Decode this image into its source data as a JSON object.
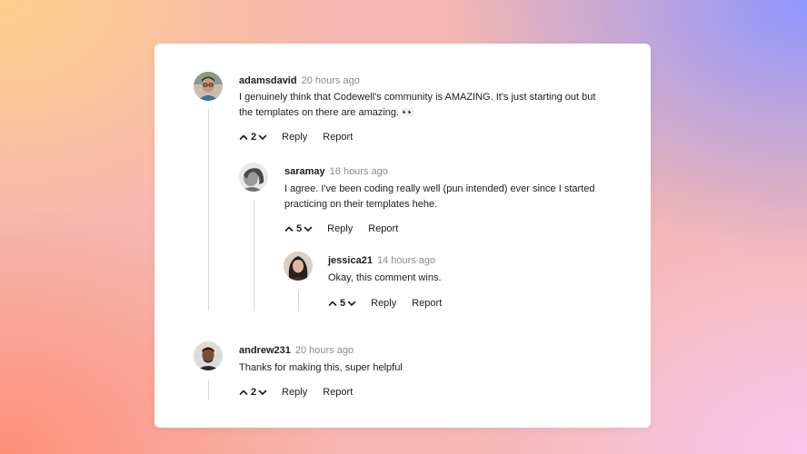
{
  "comments": [
    {
      "username": "adamsdavid",
      "time": "20 hours ago",
      "lines": [
        "I genuinely think that Codewell's community is AMAZING. It's just starting out but",
        "the templates on there are amazing. 👀"
      ],
      "votes": "2",
      "reply": "Reply",
      "report": "Report"
    },
    {
      "username": "saramay",
      "time": "16 hours ago",
      "lines": [
        "I agree. I've been coding really well (pun intended) ever since I started",
        "practicing on their templates hehe."
      ],
      "votes": "5",
      "reply": "Reply",
      "report": "Report"
    },
    {
      "username": "jessica21",
      "time": "14 hours ago",
      "lines": [
        "Okay, this comment wins."
      ],
      "votes": "5",
      "reply": "Reply",
      "report": "Report"
    },
    {
      "username": "andrew231",
      "time": "20 hours ago",
      "lines": [
        "Thanks for making this, super helpful"
      ],
      "votes": "2",
      "reply": "Reply",
      "report": "Report"
    }
  ],
  "icons": {
    "upvote": "chevron-up-icon",
    "downvote": "chevron-down-icon"
  }
}
